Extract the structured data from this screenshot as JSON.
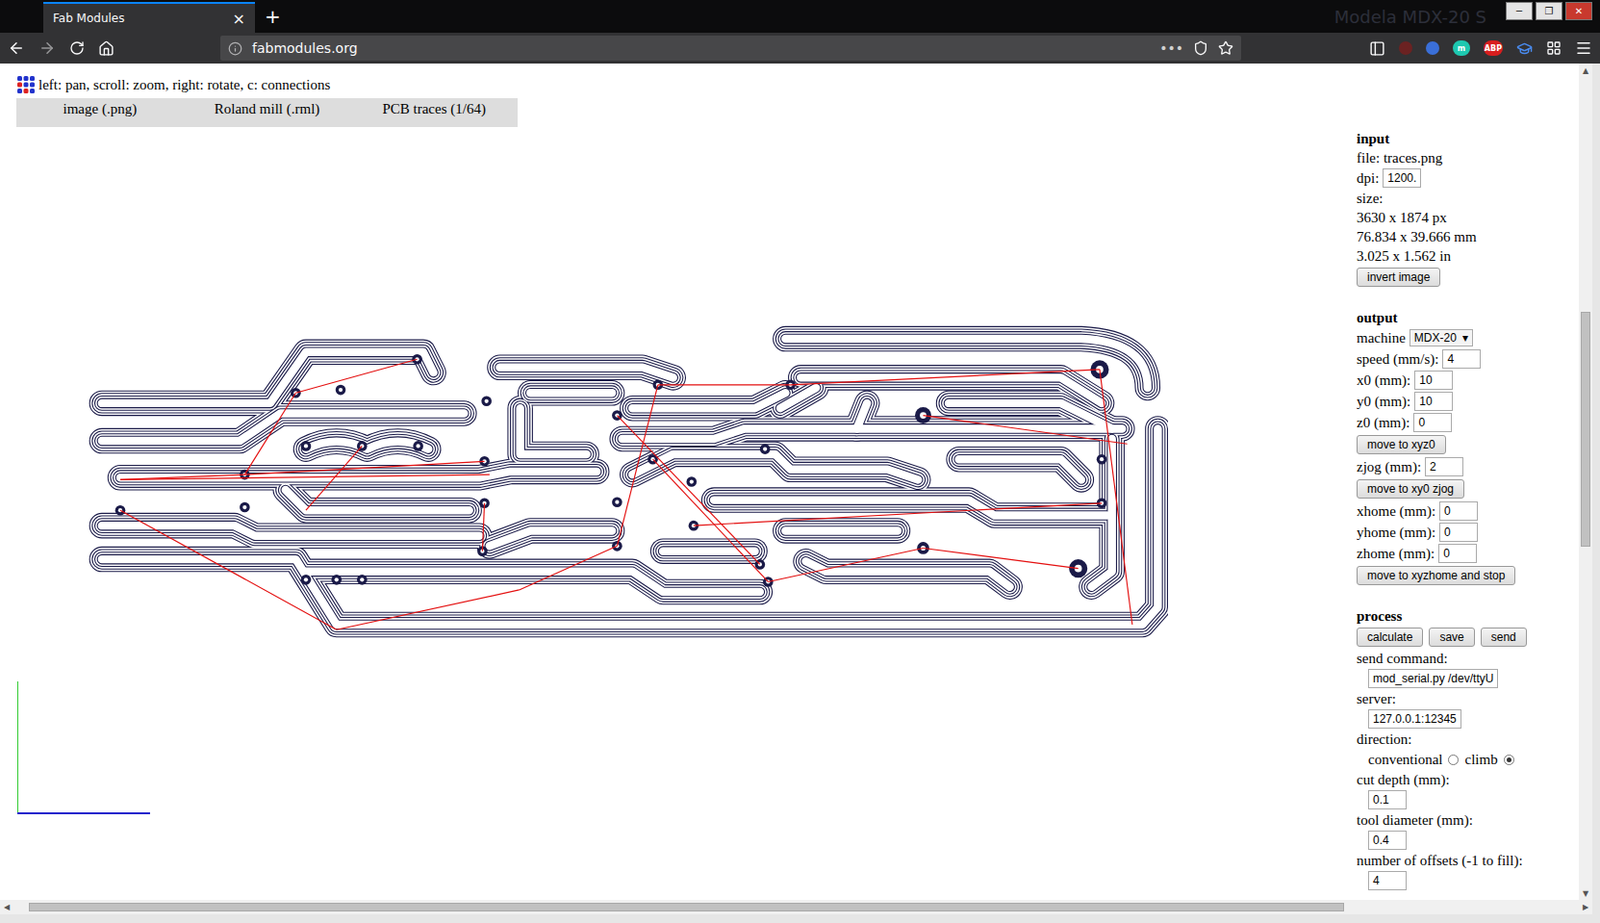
{
  "browser": {
    "tab": {
      "title": "Fab Modules",
      "close": "×",
      "selected": true
    },
    "new_tab": "+",
    "background_title": "Modela MDX-20 S",
    "window_controls": [
      "─",
      "❐",
      "✕"
    ],
    "url": "fabmodules.org",
    "page_actions": "•••",
    "extensions": [
      {
        "label": "m",
        "color": "#1ec8b0"
      },
      {
        "label": "ABP",
        "color": "#d81e1e"
      }
    ]
  },
  "page": {
    "hint": "left: pan, scroll: zoom, right: rotate, c: connections",
    "menu": [
      "image (.png)",
      "Roland mill (.rml)",
      "PCB traces (1/64)"
    ]
  },
  "panel": {
    "sections": [
      {
        "title": "input",
        "rows": [
          {
            "kind": "text",
            "text": "file: traces.png"
          },
          {
            "kind": "field",
            "label": "dpi:",
            "value": "1200."
          },
          {
            "kind": "text",
            "text": "size:"
          },
          {
            "kind": "text",
            "text": "3630 x 1874 px"
          },
          {
            "kind": "text",
            "text": "76.834 x 39.666 mm"
          },
          {
            "kind": "text",
            "text": "3.025 x 1.562 in"
          },
          {
            "kind": "buttons",
            "buttons": [
              "invert image"
            ]
          }
        ]
      },
      {
        "title": "output",
        "rows": [
          {
            "kind": "select",
            "label": "machine",
            "value": "MDX-20",
            "caret": "▾"
          },
          {
            "kind": "field",
            "label": "speed (mm/s):",
            "value": "4"
          },
          {
            "kind": "field",
            "label": "x0 (mm):",
            "value": "10"
          },
          {
            "kind": "field",
            "label": "y0 (mm):",
            "value": "10"
          },
          {
            "kind": "field",
            "label": "z0 (mm):",
            "value": "0"
          },
          {
            "kind": "buttons",
            "buttons": [
              "move to xyz0"
            ]
          },
          {
            "kind": "field",
            "label": "zjog (mm):",
            "value": "2"
          },
          {
            "kind": "buttons",
            "buttons": [
              "move to xy0 zjog"
            ]
          },
          {
            "kind": "field",
            "label": "xhome (mm):",
            "value": "0"
          },
          {
            "kind": "field",
            "label": "yhome (mm):",
            "value": "0"
          },
          {
            "kind": "field",
            "label": "zhome (mm):",
            "value": "0"
          },
          {
            "kind": "buttons",
            "buttons": [
              "move to xyzhome and stop"
            ]
          }
        ]
      },
      {
        "title": "process",
        "rows": [
          {
            "kind": "buttons",
            "buttons": [
              "calculate",
              "save",
              "send"
            ]
          },
          {
            "kind": "field_below",
            "label": "send command:",
            "value": "mod_serial.py /dev/ttyU"
          },
          {
            "kind": "field_below",
            "label": "server:",
            "value": "127.0.0.1:12345"
          },
          {
            "kind": "radios",
            "label": "direction:",
            "options": [
              {
                "label": "conventional",
                "selected": false
              },
              {
                "label": "climb",
                "selected": true
              }
            ]
          },
          {
            "kind": "field_below",
            "label": "cut depth (mm):",
            "value": "0.1"
          },
          {
            "kind": "field_below",
            "label": "tool diameter (mm):",
            "value": "0.4"
          },
          {
            "kind": "field_below",
            "label": "number of offsets (-1 to fill):",
            "value": "4"
          }
        ]
      }
    ]
  },
  "scrollbars": {
    "vertical": {
      "position": 0.29,
      "level": 0.29,
      "arrows": [
        "▲",
        "▼"
      ]
    },
    "horizontal": {
      "position": 0.01,
      "level": 0.84,
      "arrows": [
        "◀",
        "▶"
      ]
    }
  }
}
